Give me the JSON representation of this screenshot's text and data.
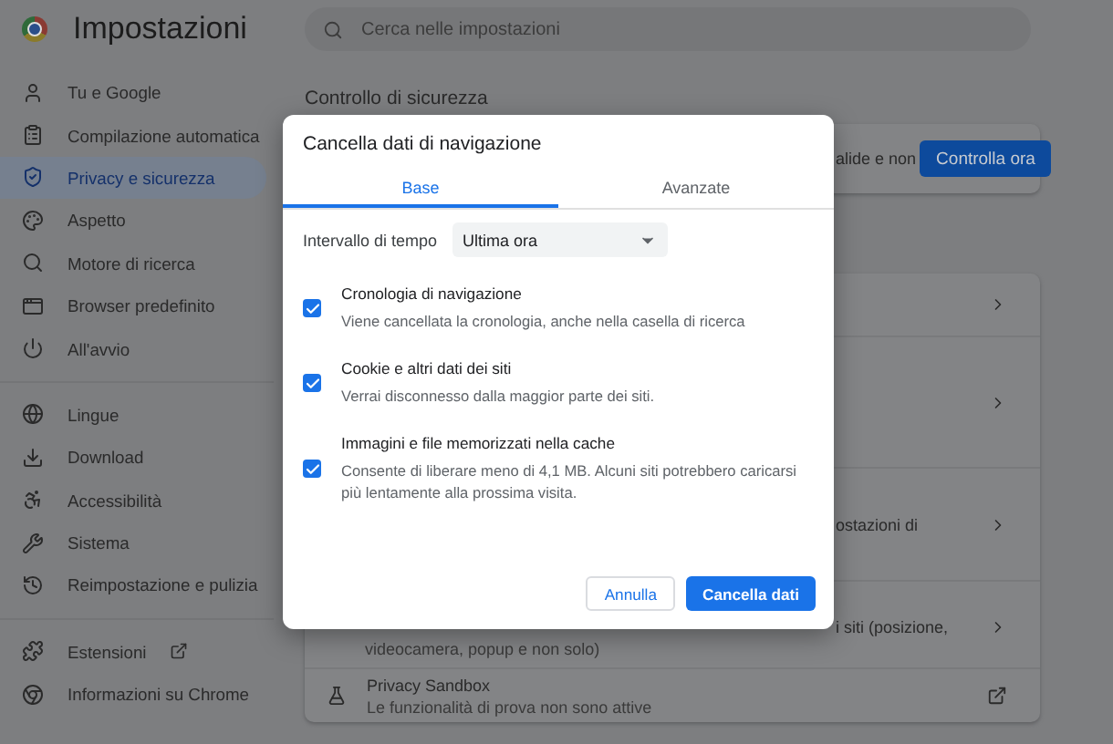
{
  "app": {
    "title": "Impostazioni"
  },
  "search": {
    "placeholder": "Cerca nelle impostazioni"
  },
  "sidebar": {
    "groups": [
      [
        {
          "label": "Tu e Google",
          "selected": false
        },
        {
          "label": "Compilazione automatica",
          "selected": false
        },
        {
          "label": "Privacy e sicurezza",
          "selected": true
        },
        {
          "label": "Aspetto",
          "selected": false
        },
        {
          "label": "Motore di ricerca",
          "selected": false
        },
        {
          "label": "Browser predefinito",
          "selected": false
        },
        {
          "label": "All'avvio",
          "selected": false
        }
      ],
      [
        {
          "label": "Lingue",
          "selected": false
        },
        {
          "label": "Download",
          "selected": false
        },
        {
          "label": "Accessibilità",
          "selected": false
        },
        {
          "label": "Sistema",
          "selected": false
        },
        {
          "label": "Reimpostazione e pulizia",
          "selected": false
        }
      ],
      [
        {
          "label": "Estensioni",
          "selected": false
        },
        {
          "label": "Informazioni su Chrome",
          "selected": false
        }
      ]
    ]
  },
  "section_title": "Controllo di sicurezza",
  "safety_card": {
    "text": "alide e non",
    "button": "Controlla ora"
  },
  "privacy_rows": [
    {
      "kind": "arrow"
    },
    {
      "kind": "arrow"
    },
    {
      "kind": "arrow",
      "text": "ostazioni di"
    },
    {
      "kind": "arrow",
      "text": "i siti (posizione,",
      "subtext": "videocamera, popup e non solo)"
    },
    {
      "kind": "external",
      "title": "Privacy Sandbox",
      "subtitle": "Le funzionalità di prova non sono attive"
    }
  ],
  "dialog": {
    "title": "Cancella dati di navigazione",
    "tabs": [
      {
        "label": "Base",
        "selected": true
      },
      {
        "label": "Avanzate",
        "selected": false
      }
    ],
    "time_range": {
      "label": "Intervallo di tempo",
      "value": "Ultima ora"
    },
    "options": [
      {
        "title": "Cronologia di navigazione",
        "description": "Viene cancellata la cronologia, anche nella casella di ricerca",
        "checked": true
      },
      {
        "title": "Cookie e altri dati dei siti",
        "description": "Verrai disconnesso dalla maggior parte dei siti.",
        "checked": true
      },
      {
        "title": "Immagini e file memorizzati nella cache",
        "description": "Consente di liberare meno di 4,1 MB. Alcuni siti potrebbero caricarsi più lentamente alla prossima visita.",
        "checked": true
      }
    ],
    "cancel_button": "Annulla",
    "confirm_button": "Cancella dati"
  }
}
